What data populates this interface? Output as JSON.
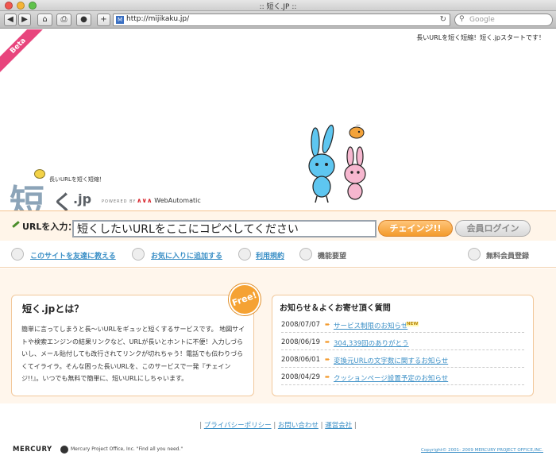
{
  "window": {
    "title": ":: 短く.JP ::"
  },
  "toolbar": {
    "back": "◀",
    "forward": "▶",
    "home": "⌂",
    "print": "⎙",
    "plus": "+"
  },
  "address": {
    "url": "http://mijikaku.jp/",
    "reload": "↻"
  },
  "search": {
    "placeholder": "Google",
    "icon": "search-icon"
  },
  "page": {
    "beta": "Beta",
    "tagline": "長いURLを短く短縮！短く.jpスタートです！",
    "logo": {
      "sub": "長いURLを短く短縮！",
      "main": "短",
      "ku": "く",
      "jp": ".jp",
      "powered": "POWERED BY",
      "wa_brand": "WebAutomatic"
    },
    "input": {
      "label": "URLを入力：",
      "value": "短くしたいURLをここにコピペしてください",
      "change_btn": "チェインジ!!",
      "login_btn": "会員ログイン"
    },
    "nav": [
      {
        "label": "このサイトを友達に教える",
        "link": true
      },
      {
        "label": "お気に入りに追加する",
        "link": true
      },
      {
        "label": "利用規約",
        "link": true
      },
      {
        "label": "機能要望",
        "link": false
      },
      {
        "label": "無料会員登録",
        "link": false
      }
    ],
    "about": {
      "title": "短く.jpとは？",
      "body": "簡単に言ってしまうと長～いURLをギュッと短くするサービスです。 地図サイトや検索エンジンの結果リンクなど、URLが長いとホントに不便！入力しづらいし、メール貼付しても改行されてリンクが切れちゃう！電話でも伝わりづらくてイライラ。そんな困った長いURLを、このサービスで一発『チェインジ!!』。いつでも無料で簡単に、短いURLにしちゃいます。",
      "free_badge": "Free!"
    },
    "news": {
      "title": "お知らせ＆よくお寄せ頂く質問",
      "items": [
        {
          "date": "2008/07/07",
          "text": "サービス制限のお知らせ",
          "badge": "NEW"
        },
        {
          "date": "2008/06/19",
          "text": "304,339回のありがとう",
          "badge": ""
        },
        {
          "date": "2008/06/01",
          "text": "変換元URLの文字数に関するお知らせ",
          "badge": ""
        },
        {
          "date": "2008/04/29",
          "text": "クッションページ設置予定のお知らせ",
          "badge": ""
        }
      ]
    },
    "footer": {
      "links": [
        "プライバシーポリシー",
        "お問い合わせ",
        "運営会社"
      ],
      "sep": "|",
      "mercury": "MERCURY",
      "mpo": "Mercury Project Office, Inc. \"Find all you need.\"",
      "copyright": "Copyright© 2001- 2009 MERCURY PROJECT OFFICE,INC."
    }
  }
}
